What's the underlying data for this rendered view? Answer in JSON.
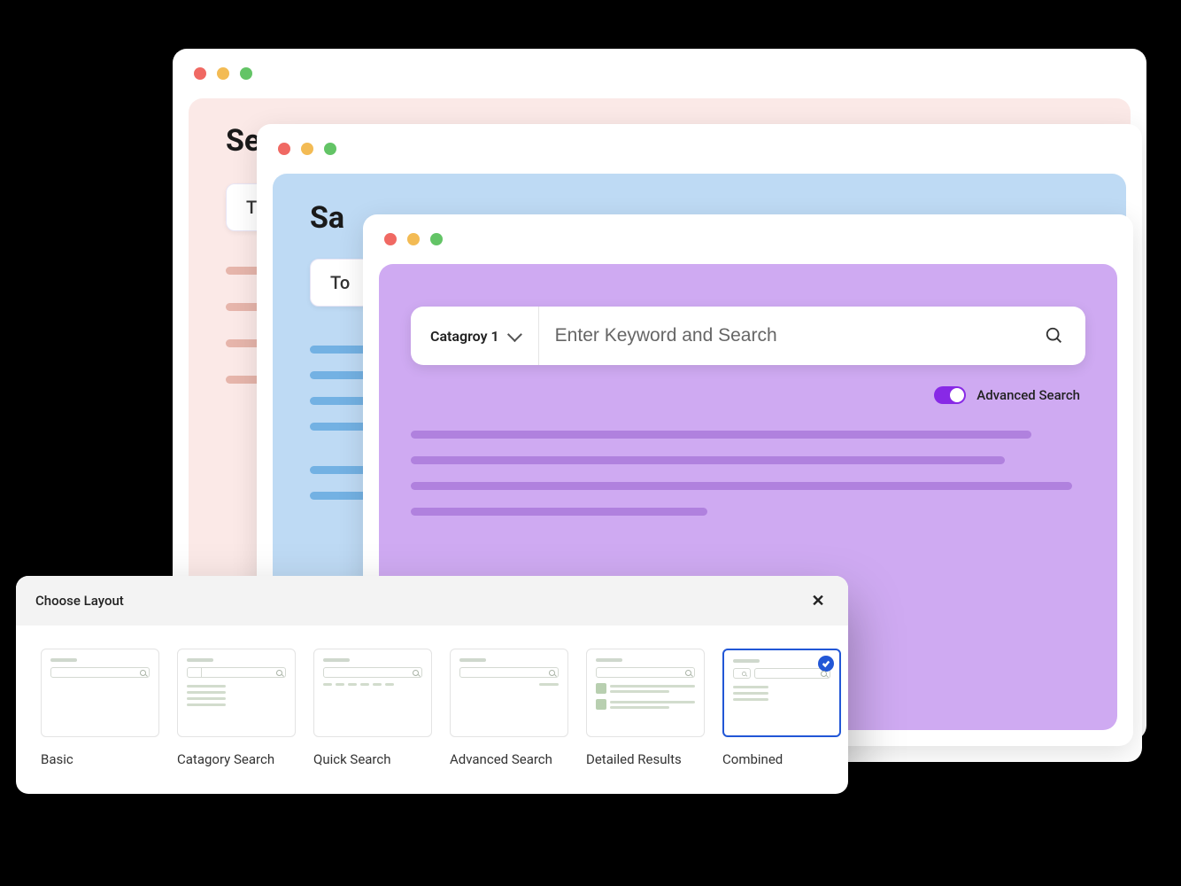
{
  "windows": {
    "pink": {
      "heading": "Se",
      "chip": "T"
    },
    "blue": {
      "heading": "Sa",
      "chip": "To"
    },
    "purple": {
      "category": "Catagroy 1",
      "placeholder": "Enter Keyword and Search",
      "advanced_label": "Advanced Search"
    }
  },
  "chooser": {
    "title": "Choose Layout",
    "options": [
      {
        "label": "Basic"
      },
      {
        "label": "Catagory Search"
      },
      {
        "label": "Quick Search"
      },
      {
        "label": "Advanced Search"
      },
      {
        "label": "Detailed Results"
      },
      {
        "label": "Combined"
      }
    ],
    "selected_index": 5
  }
}
